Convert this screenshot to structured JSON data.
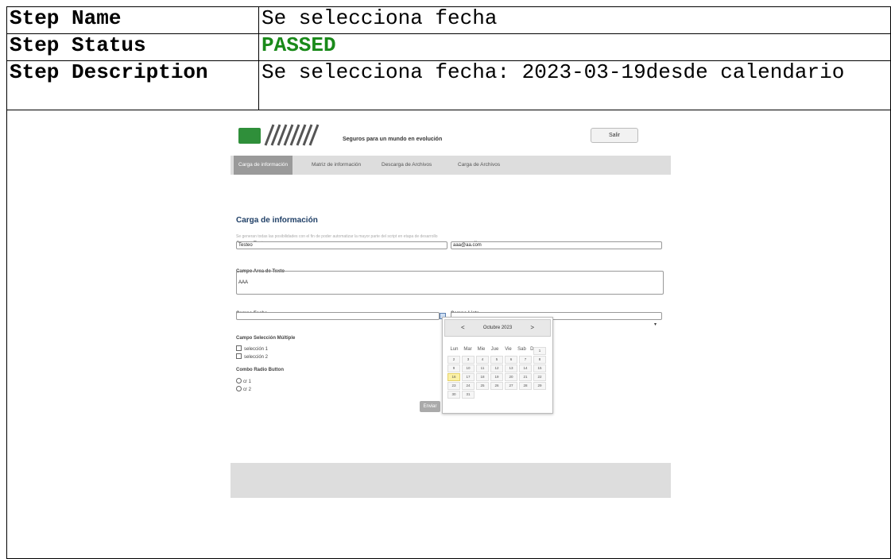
{
  "report": {
    "step_name_label": "Step Name",
    "step_name_value": "Se selecciona fecha",
    "step_status_label": "Step Status",
    "step_status_value": "PASSED",
    "step_description_label": "Step Description",
    "step_description_value": "Se selecciona fecha: 2023-03-19desde calendario"
  },
  "app": {
    "tagline": "Seguros para un mundo en evolución",
    "salir_label": "Salir",
    "nav": [
      "Carga de información",
      "Matriz de información",
      "Descarga de Archivos",
      "Carga de Archivos"
    ],
    "form_title": "Carga de información",
    "form_description": "Se generan todas las posibilidades con el fin de poder automatizar la mayor parte del script en etapa de desarrollo",
    "campo_texto_label": "Campo Texto",
    "campo_texto_value": "Testeo",
    "campo_mail_label": "campo mail",
    "campo_mail_value": "aaa@aa.com",
    "area_label": "Campo Area de Texto",
    "area_value": "AAA",
    "fecha_label": "Campo Fecha",
    "fecha_value": "",
    "lista_label": "Campo Lista",
    "seleccion_label": "Campo Selección Múltiple",
    "seleccion_options": [
      "selección 1",
      "selección 2"
    ],
    "radio_label": "Combo Radio Button",
    "radio_options": [
      "cr 1",
      "cr 2"
    ],
    "enviar_label": "Enviar"
  },
  "datepicker": {
    "prev": "<",
    "next": ">",
    "month_label": "Octubre 2023",
    "weekdays": [
      "Lun",
      "Mar",
      "Mie",
      "Jue",
      "Vie",
      "Sab",
      "Dom"
    ],
    "weeks": [
      [
        "",
        "",
        "",
        "",
        "",
        "",
        "1"
      ],
      [
        "2",
        "3",
        "4",
        "5",
        "6",
        "7",
        "8"
      ],
      [
        "9",
        "10",
        "11",
        "12",
        "13",
        "14",
        "15"
      ],
      [
        "16",
        "17",
        "18",
        "19",
        "20",
        "21",
        "22"
      ],
      [
        "23",
        "24",
        "25",
        "26",
        "27",
        "28",
        "29"
      ],
      [
        "30",
        "31",
        "",
        "",
        "",
        "",
        ""
      ]
    ],
    "highlighted_day": "16"
  },
  "colors": {
    "passed": "#1a8a1a",
    "title": "#1f3f66",
    "today": "#fbf1a6"
  }
}
